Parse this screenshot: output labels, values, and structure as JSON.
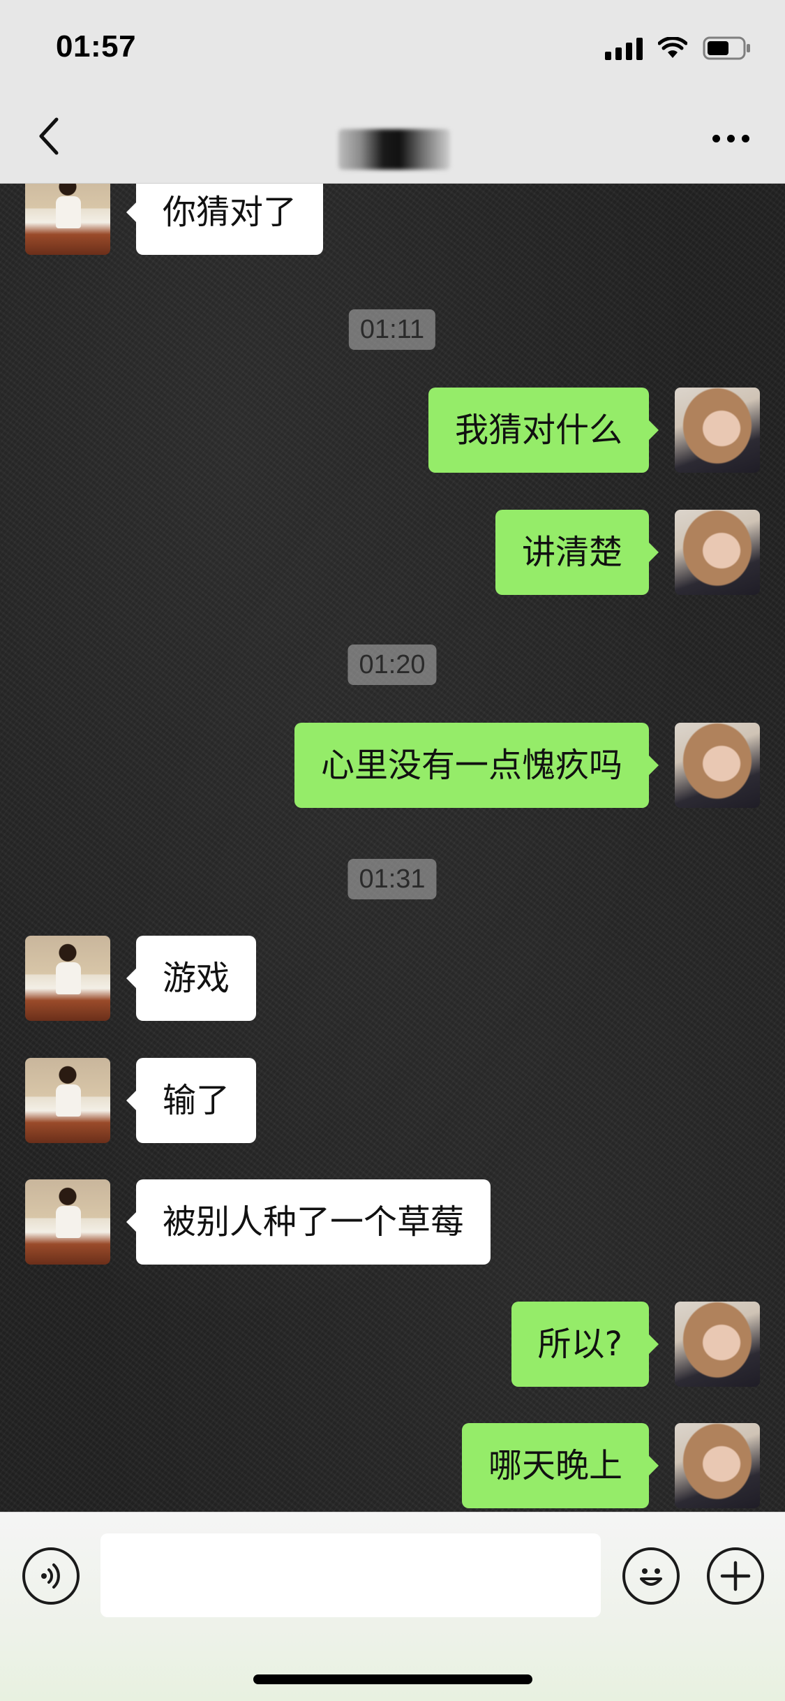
{
  "status_bar": {
    "time": "01:57",
    "icons": [
      "signal-icon",
      "wifi-icon",
      "battery-icon"
    ]
  },
  "nav": {
    "back_icon": "chevron-left-icon",
    "title": "",
    "more_icon": "more-dots-icon"
  },
  "messages": [
    {
      "side": "left",
      "text": "你猜对了"
    },
    {
      "timestamp": "01:11"
    },
    {
      "side": "right",
      "text": "我猜对什么"
    },
    {
      "side": "right",
      "text": "讲清楚"
    },
    {
      "timestamp": "01:20"
    },
    {
      "side": "right",
      "text": "心里没有一点愧疚吗"
    },
    {
      "timestamp": "01:31"
    },
    {
      "side": "left",
      "text": "游戏"
    },
    {
      "side": "left",
      "text": "输了"
    },
    {
      "side": "left",
      "text": "被别人种了一个草莓"
    },
    {
      "side": "right",
      "text": "所以?"
    },
    {
      "side": "right",
      "text": "哪天晚上"
    }
  ],
  "input_bar": {
    "voice_icon": "voice-icon",
    "text_value": "",
    "emoji_icon": "emoji-icon",
    "plus_icon": "plus-icon"
  },
  "colors": {
    "sent_bubble": "#95ec69",
    "received_bubble": "#ffffff",
    "top_bar": "#e7e7e7",
    "timestamp_bg": "#b4b4b4"
  }
}
